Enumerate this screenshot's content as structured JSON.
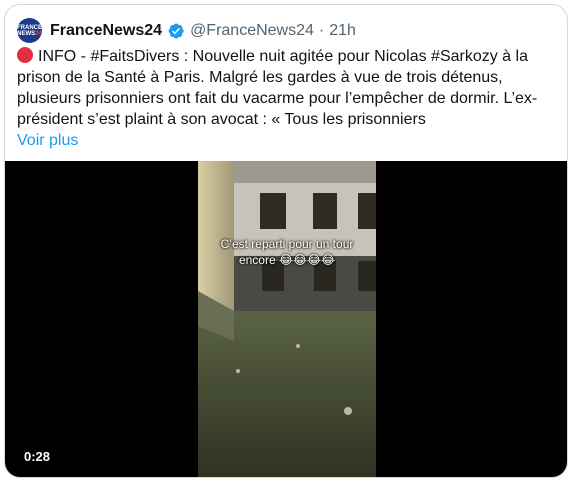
{
  "tweet": {
    "author_name": "FranceNews24",
    "handle": "@FranceNews24",
    "separator": "·",
    "time": "21h",
    "avatar_text_top": "FRANCE",
    "avatar_text_bottom_white": "NEWS",
    "avatar_text_bottom_red": "24",
    "text": "INFO - #FaitsDivers : Nouvelle nuit agitée pour Nicolas #Sarkozy à la prison de la Santé à Paris. Malgré les gardes à vue de trois détenus, plusieurs prisonniers ont fait du vacarme pour l’empêcher de dormir. L’ex-président s’est plaint à son avocat : « Tous les prisonniers",
    "show_more": "Voir plus",
    "verified_color": "#1d9bf0",
    "icons": [
      "red-circle-emoji",
      "verified-badge-icon"
    ]
  },
  "video": {
    "caption_line1": "C’est reparti pour un tour",
    "caption_line2": "encore 😂😂😂😂",
    "duration": "0:28"
  }
}
